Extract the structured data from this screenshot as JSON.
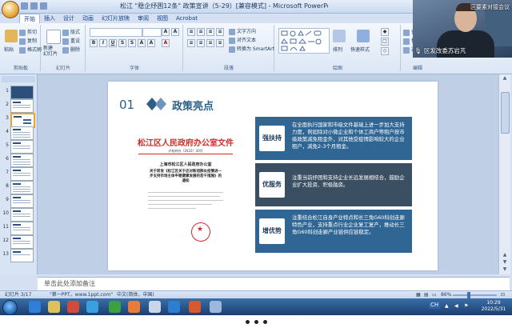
{
  "window": {
    "title": "松江 \"稳企纾困12条\" 政策宣讲（5-29）[兼容模式] - Microsoft PowerPoint"
  },
  "ribbon": {
    "tabs": [
      "开始",
      "插入",
      "设计",
      "动画",
      "幻灯片放映",
      "审阅",
      "视图",
      "Acrobat"
    ],
    "active_tab": "开始",
    "clipboard": {
      "paste": "粘贴",
      "cut": "剪切",
      "copy": "复制",
      "format_painter": "格式刷",
      "label": "剪贴板"
    },
    "slides": {
      "new_slide": "新建\n幻灯片",
      "layout": "版式",
      "reset": "重设",
      "delete": "删除",
      "label": "幻灯片"
    },
    "font": {
      "label": "字体"
    },
    "paragraph": {
      "text_direction": "文字方向",
      "align_text": "对齐文本",
      "smartart": "转换为 SmartArt",
      "label": "段落"
    },
    "drawing": {
      "arrange": "排列",
      "quick_styles": "快速样式",
      "label": "绘图"
    },
    "editing": {
      "find": "查找",
      "replace": "替换",
      "select": "选择",
      "label": "编辑"
    }
  },
  "slide": {
    "number": "01",
    "title": "政策亮点",
    "document": {
      "header": "松江区人民政府办公室文件",
      "doc_no": "沪松府办〔2022〕30号",
      "office": "上海市松江区人民政府办公室",
      "subject": "关于转发《松江区关于应对新冠肺炎疫情进一步支持市场主体平稳健康发展的若干措施》的通知"
    },
    "bullets": [
      {
        "label": "强扶持",
        "text": "在全面执行国家和市级文件基础上进一步加大支持力度，例如除对小微企业和个体工商户等租户按市级政策减免租金外，对其他受疫情影响较大的企业租户，减免2-3个月租金。"
      },
      {
        "label": "优服务",
        "text": "注重当前纾困和支持企业长远发展相结合，鼓励企业扩大投资、积极融资。"
      },
      {
        "label": "增优势",
        "text": "注重结合松江自身产业特点和长三角G60科创走廊特色产业，支持重点行业企业复工复产，推动长三角G60科创走廊产业链供应链稳定。"
      }
    ]
  },
  "notes": {
    "placeholder": "单击此处添加备注"
  },
  "status": {
    "slide_pos": "幻灯片 3/17",
    "theme": "\"第一PPT，www.1ppt.com\"",
    "lang": "中文(简体，中国)",
    "zoom": "86%"
  },
  "taskbar": {
    "lang": "CH",
    "time": "10:29",
    "date": "2022/5/31"
  },
  "webcam": {
    "top_label": "区要素对接会议",
    "name": "区发改委苏岩芃"
  },
  "colors": {
    "accent": "#2f6694",
    "title_blue": "#2c5f86",
    "red_header": "#d22a2a"
  }
}
